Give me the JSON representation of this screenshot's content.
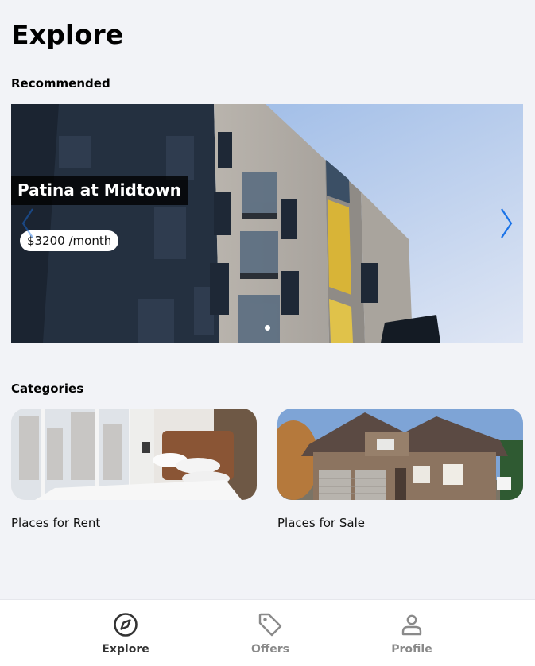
{
  "page": {
    "title": "Explore"
  },
  "recommended": {
    "section_label": "Recommended",
    "listing": {
      "name": "Patina at Midtown",
      "price": "$3200 /month"
    },
    "carousel": {
      "slide_count": 1,
      "active_slide": 1,
      "arrow_color": "#1a73e8"
    }
  },
  "categories": {
    "section_label": "Categories",
    "items": [
      {
        "label": "Places for Rent",
        "image": "bedroom-photo"
      },
      {
        "label": "Places for Sale",
        "image": "house-photo"
      }
    ]
  },
  "bottom_nav": {
    "items": [
      {
        "label": "Explore",
        "icon": "compass-icon",
        "active": true
      },
      {
        "label": "Offers",
        "icon": "tag-icon",
        "active": false
      },
      {
        "label": "Profile",
        "icon": "person-icon",
        "active": false
      }
    ]
  }
}
